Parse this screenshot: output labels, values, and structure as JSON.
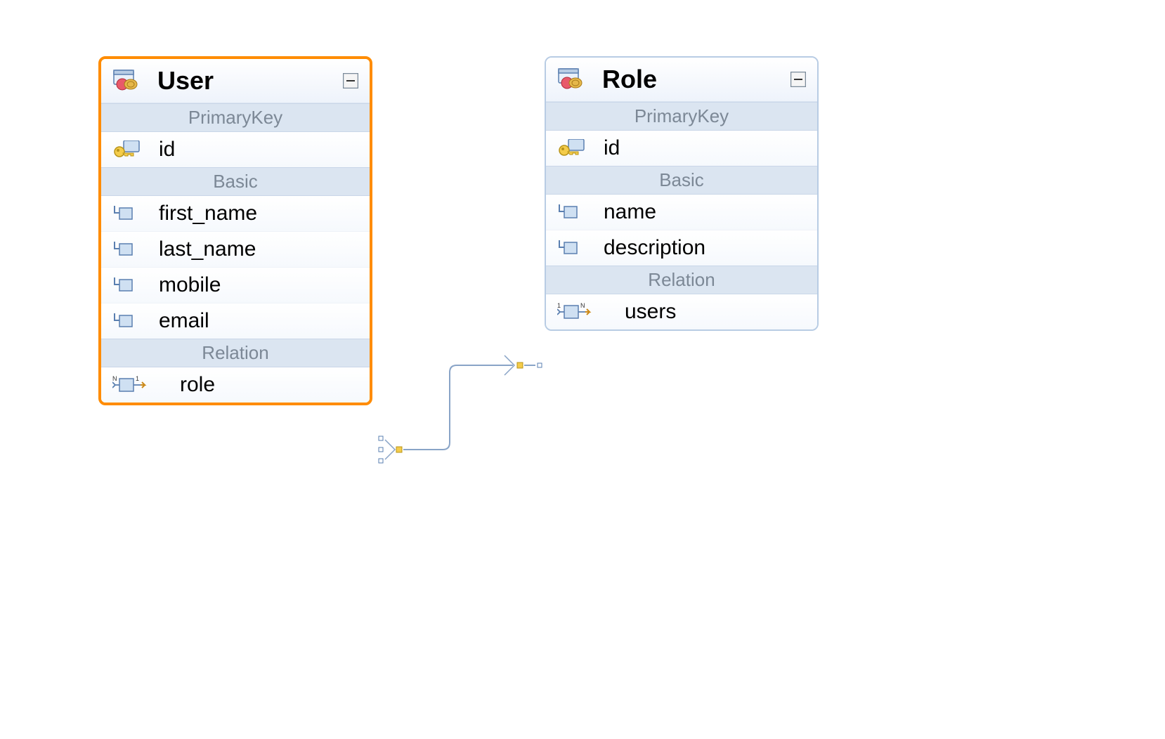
{
  "entities": {
    "user": {
      "title": "User",
      "sections": {
        "primaryKey": {
          "label": "PrimaryKey",
          "fields": [
            {
              "name": "id"
            }
          ]
        },
        "basic": {
          "label": "Basic",
          "fields": [
            {
              "name": "first_name"
            },
            {
              "name": "last_name"
            },
            {
              "name": "mobile"
            },
            {
              "name": "email"
            }
          ]
        },
        "relation": {
          "label": "Relation",
          "fields": [
            {
              "name": "role"
            }
          ]
        }
      }
    },
    "role": {
      "title": "Role",
      "sections": {
        "primaryKey": {
          "label": "PrimaryKey",
          "fields": [
            {
              "name": "id"
            }
          ]
        },
        "basic": {
          "label": "Basic",
          "fields": [
            {
              "name": "name"
            },
            {
              "name": "description"
            }
          ]
        },
        "relation": {
          "label": "Relation",
          "fields": [
            {
              "name": "users"
            }
          ]
        }
      }
    }
  }
}
